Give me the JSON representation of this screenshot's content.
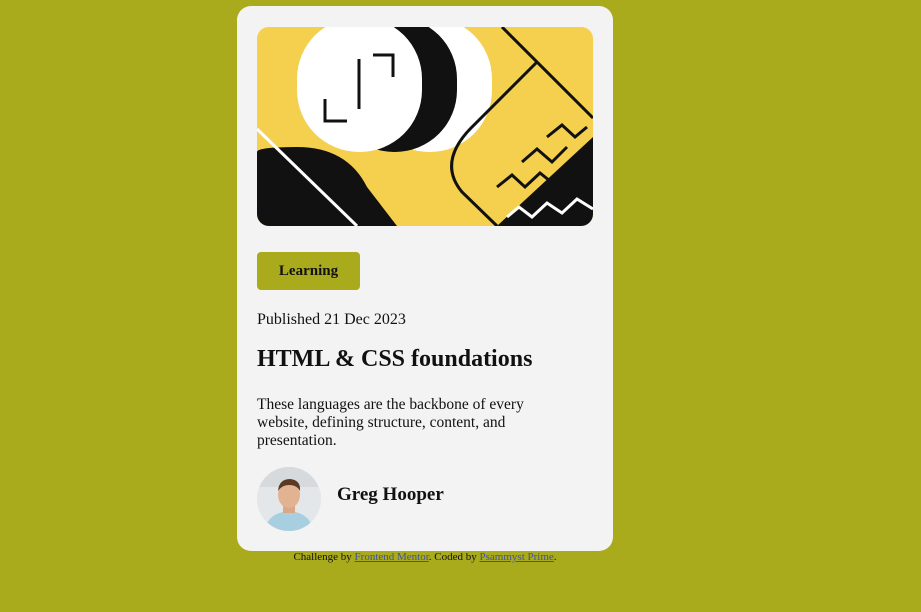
{
  "card": {
    "tag": "Learning",
    "published": "Published 21 Dec 2023",
    "title": "HTML & CSS foundations",
    "description": "These languages are the backbone of every website, defining structure, content, and presentation.",
    "author": "Greg Hooper",
    "hero_icon": "code-brackets-illustration",
    "avatar_icon": "author-avatar-photo"
  },
  "footer": {
    "prefix": "Challenge by ",
    "link1": "Frontend Mentor",
    "middle": ". Coded by ",
    "link2": "Psammyst Prime",
    "suffix": "."
  },
  "colors": {
    "background": "#a9ab1c",
    "card": "#f3f3f3",
    "hero_yellow": "#f4d04e",
    "tag_bg": "#a9ab1c",
    "text": "#111111",
    "link": "#3e52a3"
  }
}
